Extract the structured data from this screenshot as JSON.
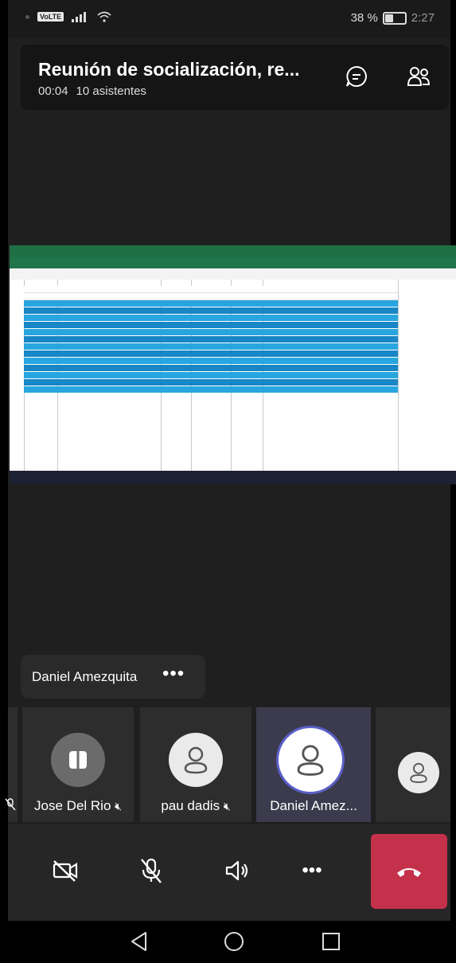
{
  "status_bar": {
    "volte": "VoLTE",
    "battery": "38 %",
    "battery_level": 0.38,
    "time": "2:27"
  },
  "meeting": {
    "title": "Reunión de socialización, re...",
    "elapsed": "00:04",
    "attendees": "10 asistentes",
    "chat_icon": "chat-icon",
    "people_icon": "people-icon"
  },
  "shared_content": {
    "description_icon": "excel-spreadsheet-share"
  },
  "speaker_chip": {
    "name": "Daniel Amezquita",
    "more": "•••"
  },
  "participants": [
    {
      "name": "",
      "muted": true
    },
    {
      "name": "Jose Del Rio",
      "muted": true
    },
    {
      "name": "pau dadis",
      "muted": true
    },
    {
      "name": "Daniel Amez...",
      "muted": false,
      "active": true
    },
    {
      "name": "",
      "muted": false
    }
  ],
  "controls": {
    "camera": "camera-off-icon",
    "mic": "mic-off-icon",
    "speaker": "speaker-icon",
    "more": "•••",
    "hangup": "hang-up-icon"
  },
  "navigation": {
    "back": "back-icon",
    "home": "home-icon",
    "recents": "recents-icon"
  }
}
